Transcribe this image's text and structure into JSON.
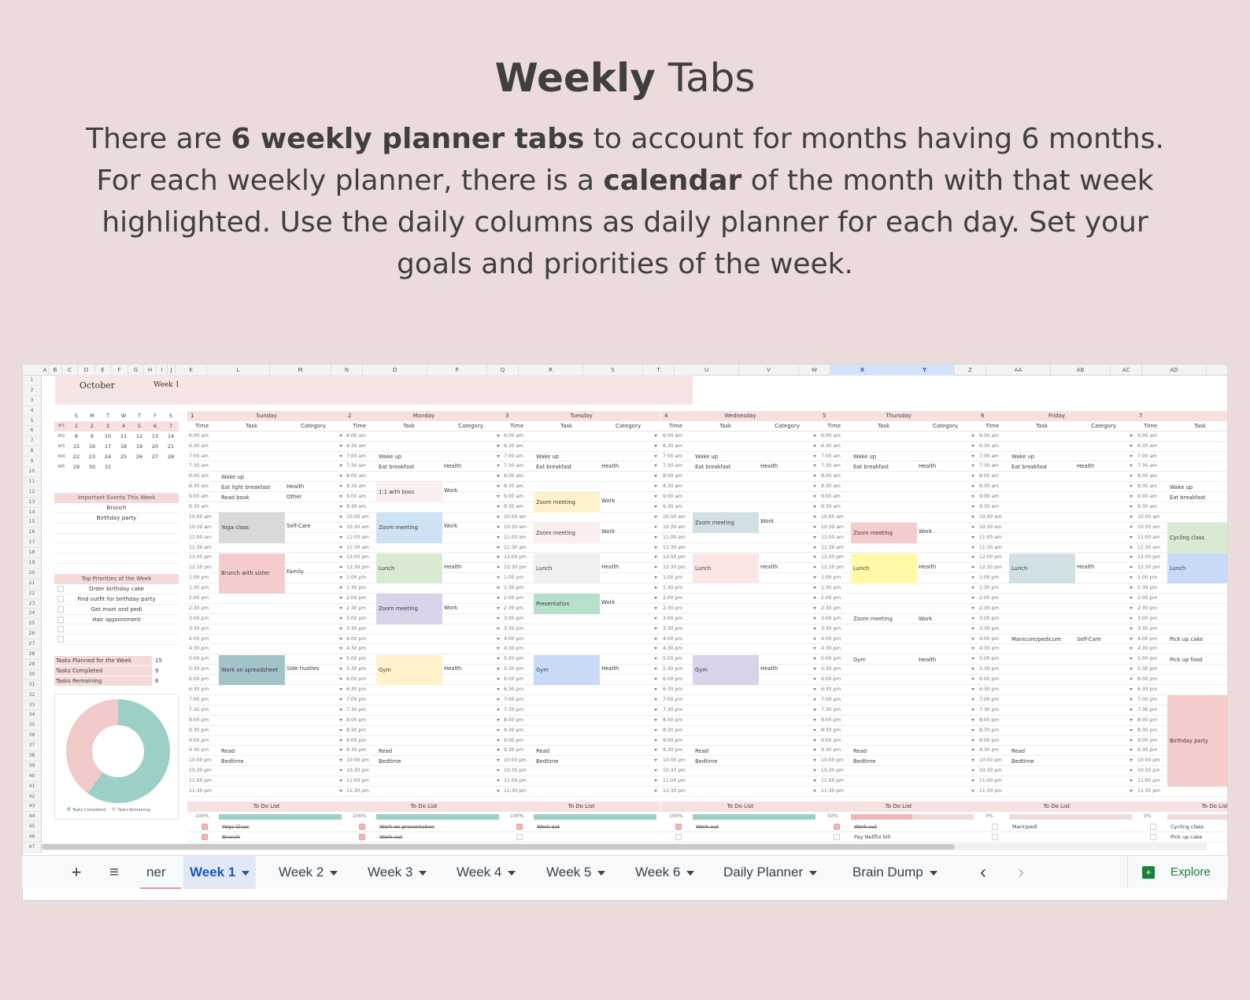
{
  "heading": {
    "bold": "Weekly",
    "rest": " Tabs"
  },
  "description": {
    "p1": "There are ",
    "b1": "6 weekly planner tabs",
    "p2": " to account for months having 6 months. For each weekly planner, there is a ",
    "b2": "calendar",
    "p3": " of the month with that week highlighted. Use the daily columns as daily planner for each day. Set your goals and priorities of the week."
  },
  "sheet": {
    "columns": [
      "A",
      "B",
      "C",
      "D",
      "E",
      "F",
      "G",
      "H",
      "I",
      "J",
      "K",
      "L",
      "M",
      "N",
      "O",
      "P",
      "Q",
      "R",
      "S",
      "T",
      "U",
      "V",
      "W",
      "X",
      "Y",
      "Z",
      "AA",
      "AB",
      "AC",
      "AD"
    ],
    "selected_columns": [
      "X",
      "Y"
    ],
    "rows": [
      "1",
      "2",
      "3",
      "4",
      "5",
      "6",
      "7",
      "8",
      "9",
      "10",
      "11",
      "12",
      "13",
      "14",
      "15",
      "16",
      "17",
      "18",
      "19",
      "20",
      "21",
      "22",
      "23",
      "24",
      "25",
      "26",
      "27",
      "28",
      "29",
      "30",
      "31",
      "32",
      "33",
      "34",
      "35",
      "36",
      "37",
      "38",
      "39",
      "40",
      "41",
      "42",
      "43",
      "44",
      "45",
      "46",
      "47"
    ],
    "banner_month": "October",
    "banner_week": "Week 1",
    "calendar": {
      "days": [
        "S",
        "M",
        "T",
        "W",
        "T",
        "F",
        "S"
      ],
      "weeks": [
        {
          "label": "W1",
          "dates": [
            "1",
            "2",
            "3",
            "4",
            "5",
            "6",
            "7"
          ]
        },
        {
          "label": "W2",
          "dates": [
            "8",
            "9",
            "10",
            "11",
            "12",
            "13",
            "14"
          ]
        },
        {
          "label": "W3",
          "dates": [
            "15",
            "16",
            "17",
            "18",
            "19",
            "20",
            "21"
          ]
        },
        {
          "label": "W4",
          "dates": [
            "22",
            "23",
            "24",
            "25",
            "26",
            "27",
            "28"
          ]
        },
        {
          "label": "W5",
          "dates": [
            "29",
            "30",
            "31",
            "",
            "",
            "",
            ""
          ]
        }
      ]
    },
    "events": {
      "header": "Important Events This Week",
      "items": [
        "Brunch",
        "Birthday party",
        "",
        "",
        "",
        ""
      ]
    },
    "priorities": {
      "header": "Top Priorities of the Week",
      "items": [
        "Order birthday cake",
        "Find outfit for birthday party",
        "Get mani and pedi",
        "Hair appointment",
        "",
        ""
      ]
    },
    "stats": [
      {
        "label": "Tasks Planned for the Week",
        "value": "15"
      },
      {
        "label": "Tasks Completed",
        "value": "9"
      },
      {
        "label": "Tasks Remaining",
        "value": "6"
      }
    ],
    "chart_data": {
      "type": "pie",
      "categories": [
        "Tasks Completed",
        "Tasks Remaining"
      ],
      "values": [
        9,
        6
      ],
      "colors": [
        "#9ccfc6",
        "#f2c9c9"
      ]
    },
    "time_labels": [
      "6:00 am",
      "6:30 am",
      "7:00 am",
      "7:30 am",
      "8:00 am",
      "8:30 am",
      "9:00 am",
      "9:30 am",
      "10:00 am",
      "10:30 am",
      "11:00 am",
      "11:30 am",
      "12:00 pm",
      "12:30 pm",
      "1:00 pm",
      "1:30 pm",
      "2:00 pm",
      "2:30 pm",
      "3:00 pm",
      "3:30 pm",
      "4:00 pm",
      "4:30 pm",
      "5:00 pm",
      "5:30 pm",
      "6:00 pm",
      "6:30 pm",
      "7:00 pm",
      "7:30 pm",
      "8:00 pm",
      "8:30 pm",
      "9:00 pm",
      "9:30 pm",
      "10:00 pm",
      "10:30 pm",
      "11:00 pm",
      "11:30 pm"
    ],
    "sub_headers": {
      "time": "Time",
      "task": "Task",
      "category": "Category"
    },
    "todo_header": "To Do List",
    "days": [
      {
        "num": "1",
        "name": "Sunday",
        "tasks": [
          {
            "slot": 4,
            "span": 1,
            "text": "Wake up",
            "color": ""
          },
          {
            "slot": 5,
            "span": 1,
            "text": "Eat light breakfast",
            "color": "",
            "cat": "Health"
          },
          {
            "slot": 6,
            "span": 1,
            "text": "Read book",
            "color": "",
            "cat": "Other"
          },
          {
            "slot": 8,
            "span": 3,
            "text": "Yoga class",
            "color": "#d9d9d9",
            "cat": "Self-Care"
          },
          {
            "slot": 12,
            "span": 4,
            "text": "Brunch with sister",
            "color": "#f4cccc",
            "cat": "Family"
          },
          {
            "slot": 22,
            "span": 3,
            "text": "Work on spreadsheet",
            "color": "#a2c4c9",
            "cat": "Side hustles"
          },
          {
            "slot": 31,
            "span": 1,
            "text": "Read",
            "color": ""
          },
          {
            "slot": 32,
            "span": 1,
            "text": "Bedtime",
            "color": ""
          }
        ],
        "todo": {
          "pct": "100%",
          "fill": 1,
          "items": [
            {
              "t": "Yoga Class",
              "d": true
            },
            {
              "t": "Brunch",
              "d": true
            }
          ]
        }
      },
      {
        "num": "2",
        "name": "Monday",
        "tasks": [
          {
            "slot": 2,
            "span": 1,
            "text": "Wake up",
            "color": ""
          },
          {
            "slot": 3,
            "span": 1,
            "text": "Eat breakfast",
            "color": "",
            "cat": "Health"
          },
          {
            "slot": 5,
            "span": 2,
            "text": "1:1 with boss",
            "color": "#fbeeee",
            "cat": "Work"
          },
          {
            "slot": 8,
            "span": 3,
            "text": "Zoom meeting",
            "color": "#cfe2f3",
            "cat": "Work"
          },
          {
            "slot": 12,
            "span": 3,
            "text": "Lunch",
            "color": "#d9ead3",
            "cat": "Health"
          },
          {
            "slot": 16,
            "span": 3,
            "text": "Zoom meeting",
            "color": "#d9d2e9",
            "cat": "Work"
          },
          {
            "slot": 22,
            "span": 3,
            "text": "Gym",
            "color": "#fff2cc",
            "cat": "Health"
          },
          {
            "slot": 31,
            "span": 1,
            "text": "Read",
            "color": ""
          },
          {
            "slot": 32,
            "span": 1,
            "text": "Bedtime",
            "color": ""
          }
        ],
        "todo": {
          "pct": "100%",
          "fill": 1,
          "items": [
            {
              "t": "Work on presentation",
              "d": true
            },
            {
              "t": "Work out",
              "d": true
            }
          ]
        }
      },
      {
        "num": "3",
        "name": "Tuesday",
        "tasks": [
          {
            "slot": 2,
            "span": 1,
            "text": "Wake up",
            "color": ""
          },
          {
            "slot": 3,
            "span": 1,
            "text": "Eat breakfast",
            "color": "",
            "cat": "Health"
          },
          {
            "slot": 6,
            "span": 2,
            "text": "Zoom meeting",
            "color": "#fdf2cc",
            "cat": "Work"
          },
          {
            "slot": 9,
            "span": 2,
            "text": "Zoom meeting",
            "color": "#fbeeee",
            "cat": "Work"
          },
          {
            "slot": 12,
            "span": 3,
            "text": "Lunch",
            "color": "#efefef",
            "cat": "Health"
          },
          {
            "slot": 16,
            "span": 2,
            "text": "Presentation",
            "color": "#b6dfcc",
            "cat": "Work"
          },
          {
            "slot": 22,
            "span": 3,
            "text": "Gym",
            "color": "#c9daf8",
            "cat": "Health"
          },
          {
            "slot": 31,
            "span": 1,
            "text": "Read",
            "color": ""
          },
          {
            "slot": 32,
            "span": 1,
            "text": "Bedtime",
            "color": ""
          }
        ],
        "todo": {
          "pct": "100%",
          "fill": 1,
          "items": [
            {
              "t": "Work out",
              "d": true
            },
            {
              "t": "",
              "d": false
            }
          ]
        }
      },
      {
        "num": "4",
        "name": "Wednesday",
        "tasks": [
          {
            "slot": 2,
            "span": 1,
            "text": "Wake up",
            "color": ""
          },
          {
            "slot": 3,
            "span": 1,
            "text": "Eat breakfast",
            "color": "",
            "cat": "Health"
          },
          {
            "slot": 8,
            "span": 2,
            "text": "Zoom meeting",
            "color": "#d0e0e3",
            "cat": "Work"
          },
          {
            "slot": 12,
            "span": 3,
            "text": "Lunch",
            "color": "#fce5e5",
            "cat": "Health"
          },
          {
            "slot": 22,
            "span": 3,
            "text": "Gym",
            "color": "#d9d2e9",
            "cat": "Health"
          },
          {
            "slot": 31,
            "span": 1,
            "text": "Read",
            "color": ""
          },
          {
            "slot": 32,
            "span": 1,
            "text": "Bedtime",
            "color": ""
          }
        ],
        "todo": {
          "pct": "100%",
          "fill": 1,
          "items": [
            {
              "t": "Work out",
              "d": true
            },
            {
              "t": "",
              "d": false
            }
          ]
        }
      },
      {
        "num": "5",
        "name": "Thursday",
        "tasks": [
          {
            "slot": 2,
            "span": 1,
            "text": "Wake up",
            "color": ""
          },
          {
            "slot": 3,
            "span": 1,
            "text": "Eat breakfast",
            "color": "",
            "cat": "Health"
          },
          {
            "slot": 9,
            "span": 2,
            "text": "Zoom meeting",
            "color": "#f4cccc",
            "cat": "Work"
          },
          {
            "slot": 12,
            "span": 3,
            "text": "Lunch",
            "color": "#fff9a8",
            "cat": "Health"
          },
          {
            "slot": 18,
            "span": 1,
            "text": "Zoom meeting",
            "color": "",
            "cat": "Work"
          },
          {
            "slot": 22,
            "span": 1,
            "text": "Gym",
            "color": "",
            "cat": "Health"
          },
          {
            "slot": 31,
            "span": 1,
            "text": "Read",
            "color": ""
          },
          {
            "slot": 32,
            "span": 1,
            "text": "Bedtime",
            "color": ""
          }
        ],
        "todo": {
          "pct": "50%",
          "fill": 0.5,
          "items": [
            {
              "t": "Work out",
              "d": true
            },
            {
              "t": "Pay Netflix bill",
              "d": false
            }
          ]
        }
      },
      {
        "num": "6",
        "name": "Friday",
        "tasks": [
          {
            "slot": 2,
            "span": 1,
            "text": "Wake up",
            "color": ""
          },
          {
            "slot": 3,
            "span": 1,
            "text": "Eat breakfast",
            "color": "",
            "cat": "Health"
          },
          {
            "slot": 12,
            "span": 3,
            "text": "Lunch",
            "color": "#d0e0e3",
            "cat": "Health"
          },
          {
            "slot": 20,
            "span": 1,
            "text": "Manicure/pedicure",
            "color": "",
            "cat": "Self-Care"
          },
          {
            "slot": 31,
            "span": 1,
            "text": "Read",
            "color": ""
          },
          {
            "slot": 32,
            "span": 1,
            "text": "Bedtime",
            "color": ""
          }
        ],
        "todo": {
          "pct": "0%",
          "fill": 0,
          "items": [
            {
              "t": "Mani/pedi",
              "d": false
            },
            {
              "t": "",
              "d": false
            }
          ]
        }
      },
      {
        "num": "7",
        "name": "",
        "tasks": [
          {
            "slot": 5,
            "span": 1,
            "text": "Wake up",
            "color": ""
          },
          {
            "slot": 6,
            "span": 1,
            "text": "Eat breakfast",
            "color": ""
          },
          {
            "slot": 9,
            "span": 3,
            "text": "Cycling class",
            "color": "#d9ead3"
          },
          {
            "slot": 12,
            "span": 3,
            "text": "Lunch",
            "color": "#c9daf8"
          },
          {
            "slot": 20,
            "span": 1,
            "text": "Pick up cake",
            "color": ""
          },
          {
            "slot": 22,
            "span": 1,
            "text": "Pick up food",
            "color": ""
          },
          {
            "slot": 26,
            "span": 9,
            "text": "Birthday party",
            "color": "#f4cccc"
          }
        ],
        "todo": {
          "pct": "0%",
          "fill": 0,
          "items": [
            {
              "t": "Cycling class",
              "d": false
            },
            {
              "t": "Pick up cake",
              "d": false
            }
          ]
        }
      }
    ]
  },
  "tabbar": {
    "add_label": "+",
    "menu_label": "≡",
    "partial_tab": "ner",
    "tabs": [
      "Week 1",
      "Week 2",
      "Week 3",
      "Week 4",
      "Week 5",
      "Week 6",
      "Daily Planner",
      "Brain Dump"
    ],
    "active_tab": "Week 1",
    "prev_label": "‹",
    "next_label": "›",
    "explore_label": "Explore",
    "explore_icon_label": "+"
  }
}
